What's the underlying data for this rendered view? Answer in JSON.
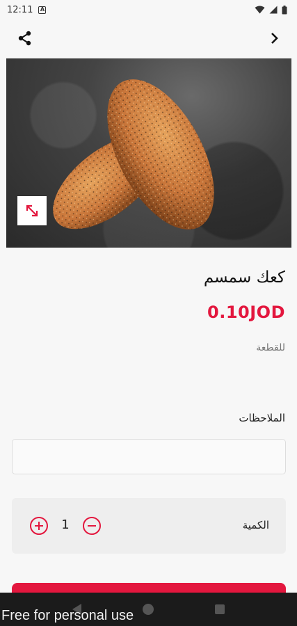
{
  "status_bar": {
    "time": "12:11",
    "icons": [
      "a-notification-icon",
      "wifi-icon",
      "cell-signal-icon",
      "battery-icon"
    ]
  },
  "top_bar": {
    "share_icon": "share-icon",
    "forward_icon": "chevron-right-icon"
  },
  "product": {
    "name": "كعك سمسم",
    "price": "0.10JOD",
    "unit": "للقطعة",
    "image_expand_icon": "expand-diagonal-icon"
  },
  "notes": {
    "label": "الملاحظات",
    "value": "",
    "placeholder": ""
  },
  "quantity": {
    "label": "الكمية",
    "value": "1",
    "plus_icon": "plus-circle-icon",
    "minus_icon": "minus-circle-icon"
  },
  "watermark": "Free for personal use",
  "colors": {
    "accent": "#e3173e",
    "background": "#f7f7f7",
    "panel": "#eeeeee",
    "nav_bar": "#1b1b1b"
  }
}
